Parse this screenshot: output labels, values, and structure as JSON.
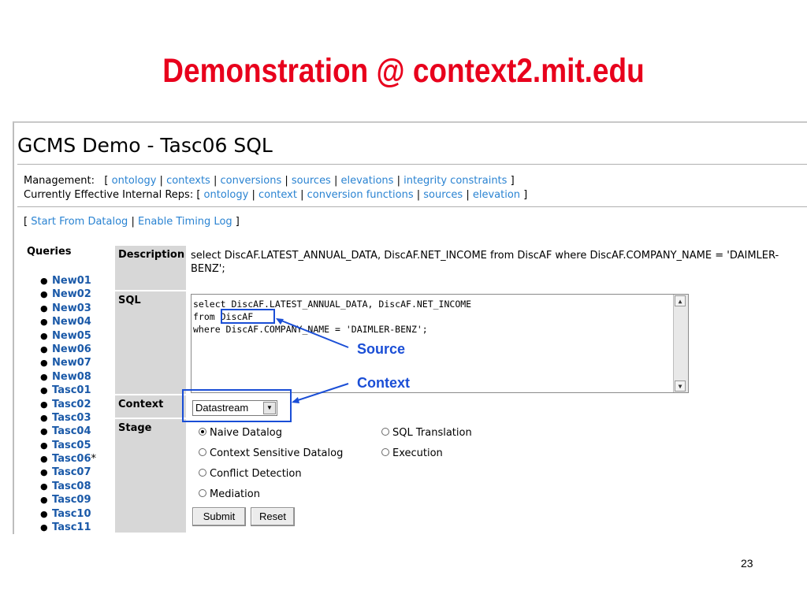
{
  "slide": {
    "title": "Demonstration @ context2.mit.edu",
    "number": "23"
  },
  "page": {
    "heading": "GCMS Demo - Tasc06 SQL",
    "management_label": "Management:",
    "management_links": [
      "ontology",
      "contexts",
      "conversions",
      "sources",
      "elevations",
      "integrity constraints"
    ],
    "internal_label": "Currently Effective Internal Reps:",
    "internal_links": [
      "ontology",
      "context",
      "conversion functions",
      "sources",
      "elevation"
    ],
    "action_links": [
      "Start From Datalog",
      "Enable Timing Log"
    ]
  },
  "sidebar": {
    "title": "Queries",
    "items": [
      "New01",
      "New02",
      "New03",
      "New04",
      "New05",
      "New06",
      "New07",
      "New08",
      "Tasc01",
      "Tasc02",
      "Tasc03",
      "Tasc04",
      "Tasc05",
      "Tasc06",
      "Tasc07",
      "Tasc08",
      "Tasc09",
      "Tasc10",
      "Tasc11"
    ],
    "current_marker": "*"
  },
  "form": {
    "description_label": "Description",
    "description_text": "select DiscAF.LATEST_ANNUAL_DATA, DiscAF.NET_INCOME from DiscAF where DiscAF.COMPANY_NAME = 'DAIMLER-BENZ';",
    "sql_label": "SQL",
    "sql_lines": [
      "select DiscAF.LATEST_ANNUAL_DATA, DiscAF.NET_INCOME",
      "from DiscAF",
      "where DiscAF.COMPANY_NAME = 'DAIMLER-BENZ';"
    ],
    "context_label": "Context",
    "context_value": "Datastream",
    "stage_label": "Stage",
    "stages": [
      "Naive Datalog",
      "SQL Translation",
      "Context Sensitive Datalog",
      "Execution",
      "Conflict Detection",
      "Mediation"
    ],
    "selected_stage": "Naive Datalog",
    "submit_label": "Submit",
    "reset_label": "Reset"
  },
  "annotations": {
    "source_label": "Source",
    "context_label": "Context",
    "color": "#1a4ed6"
  },
  "colors": {
    "title": "#e8001c",
    "link": "#2a83d2",
    "label_bg": "#d7d7d7"
  }
}
